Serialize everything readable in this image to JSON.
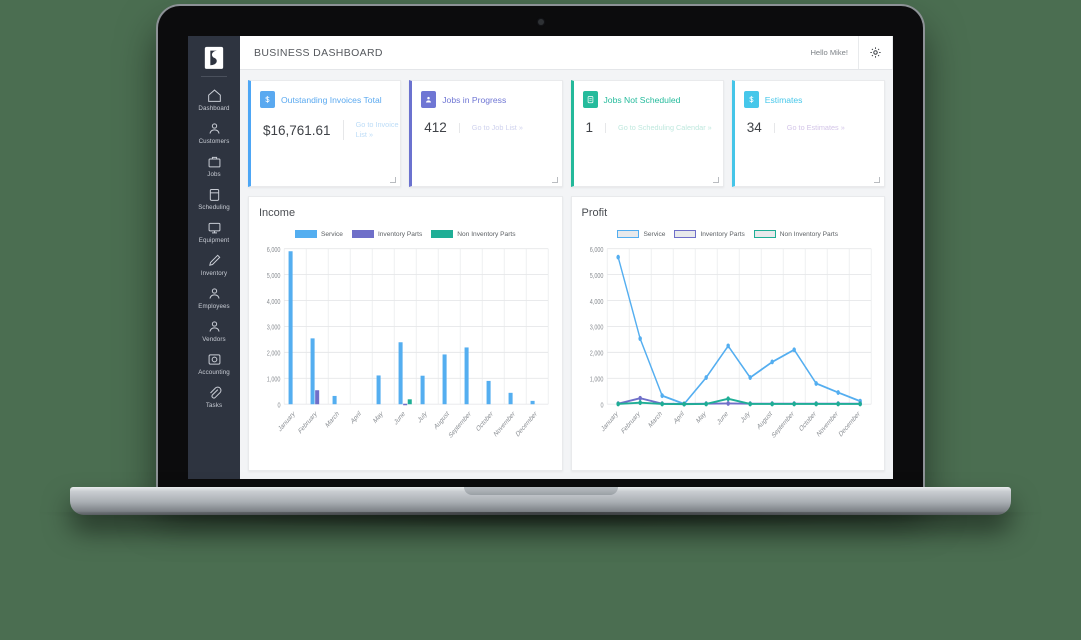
{
  "background_color": "#4b6e51",
  "device": {
    "name": "laptop-mockup",
    "webcam": "webcam-dot"
  },
  "sidebar": {
    "logo": "brand-logo-s",
    "items": [
      {
        "label": "Dashboard",
        "icon": "home-icon",
        "name": "dashboard"
      },
      {
        "label": "Customers",
        "icon": "people-icon",
        "name": "customers"
      },
      {
        "label": "Jobs",
        "icon": "briefcase-icon",
        "name": "jobs"
      },
      {
        "label": "Scheduling",
        "icon": "calendar-icon",
        "name": "scheduling"
      },
      {
        "label": "Equipment",
        "icon": "monitor-icon",
        "name": "equipment"
      },
      {
        "label": "Inventory",
        "icon": "pencil-icon",
        "name": "inventory"
      },
      {
        "label": "Employees",
        "icon": "people-icon",
        "name": "employees"
      },
      {
        "label": "Vendors",
        "icon": "people-icon",
        "name": "vendors"
      },
      {
        "label": "Accounting",
        "icon": "camera-icon",
        "name": "accounting"
      },
      {
        "label": "Tasks",
        "icon": "paperclip-icon",
        "name": "tasks"
      }
    ]
  },
  "topbar": {
    "title": "BUSINESS DASHBOARD",
    "greeting": "Hello Mike!",
    "settings_icon": "gear-icon"
  },
  "kpi_cards": [
    {
      "title": "Outstanding Invoices Total",
      "value": "$16,761.61",
      "link": "Go to Invoice List »",
      "icon": "dollar-icon",
      "accent": "#4da6f5",
      "badge_bg": "#5aa9f0",
      "title_color": "#5aa9f0",
      "link_color": "#bcdcf7"
    },
    {
      "title": "Jobs in Progress",
      "value": "412",
      "link": "Go to Job List »",
      "icon": "person-icon",
      "accent": "#6b72cf",
      "badge_bg": "#6f76d4",
      "title_color": "#6f76d4",
      "link_color": "#cfd2ee"
    },
    {
      "title": "Jobs Not Scheduled",
      "value": "1",
      "link": "Go to Scheduling Calendar »",
      "icon": "clipboard-icon",
      "accent": "#24b99a",
      "badge_bg": "#25bb9c",
      "title_color": "#25bb9c",
      "link_color": "#bfe8de"
    },
    {
      "title": "Estimates",
      "value": "34",
      "link": "Go to Estimates »",
      "icon": "dollar-icon",
      "accent": "#45c5e8",
      "badge_bg": "#46c7ea",
      "title_color": "#46c7ea",
      "link_color": "#d3c5e8"
    }
  ],
  "colors": {
    "service": "#54aef0",
    "inventory_parts": "#6f6fc9",
    "non_inventory_parts": "#1fae96",
    "grid": "#e6e7e9",
    "axis_text": "#8a8e93"
  },
  "charts": [
    {
      "chart_data": {
        "type": "bar",
        "title": "Income",
        "xlabel": "",
        "ylabel": "",
        "ylim": [
          0,
          6000
        ],
        "yticks": [
          "0",
          "1,000",
          "2,000",
          "3,000",
          "4,000",
          "5,000",
          "6,000"
        ],
        "grid": true,
        "legend_position": "top",
        "legend_style": "filled",
        "categories": [
          "January",
          "February",
          "March",
          "April",
          "May",
          "June",
          "July",
          "August",
          "September",
          "October",
          "November",
          "December"
        ],
        "series": [
          {
            "name": "Service",
            "color": "#54aef0",
            "values": [
              5900,
              2540,
              320,
              0,
              1110,
              2390,
              1100,
              1920,
              2190,
              900,
              440,
              130
            ]
          },
          {
            "name": "Inventory Parts",
            "color": "#6f6fc9",
            "values": [
              0,
              540,
              0,
              0,
              0,
              20,
              0,
              0,
              0,
              0,
              0,
              0
            ]
          },
          {
            "name": "Non Inventory Parts",
            "color": "#1fae96",
            "values": [
              0,
              0,
              0,
              0,
              0,
              190,
              0,
              0,
              0,
              0,
              0,
              0
            ]
          }
        ]
      }
    },
    {
      "chart_data": {
        "type": "line",
        "title": "Profit",
        "xlabel": "",
        "ylabel": "",
        "ylim": [
          0,
          6000
        ],
        "yticks": [
          "0",
          "1,000",
          "2,000",
          "3,000",
          "4,000",
          "5,000",
          "6,000"
        ],
        "grid": true,
        "legend_position": "top",
        "legend_style": "outline",
        "categories": [
          "January",
          "February",
          "March",
          "April",
          "May",
          "June",
          "July",
          "August",
          "September",
          "October",
          "November",
          "December"
        ],
        "series": [
          {
            "name": "Service",
            "color": "#54aef0",
            "values": [
              5670,
              2530,
              330,
              10,
              1030,
              2250,
              1030,
              1630,
              2100,
              800,
              450,
              120
            ]
          },
          {
            "name": "Inventory Parts",
            "color": "#6f6fc9",
            "values": [
              20,
              230,
              20,
              10,
              20,
              30,
              20,
              20,
              20,
              20,
              20,
              20
            ]
          },
          {
            "name": "Non Inventory Parts",
            "color": "#1fae96",
            "values": [
              10,
              60,
              10,
              5,
              10,
              210,
              10,
              10,
              10,
              10,
              10,
              10
            ]
          }
        ]
      }
    }
  ]
}
